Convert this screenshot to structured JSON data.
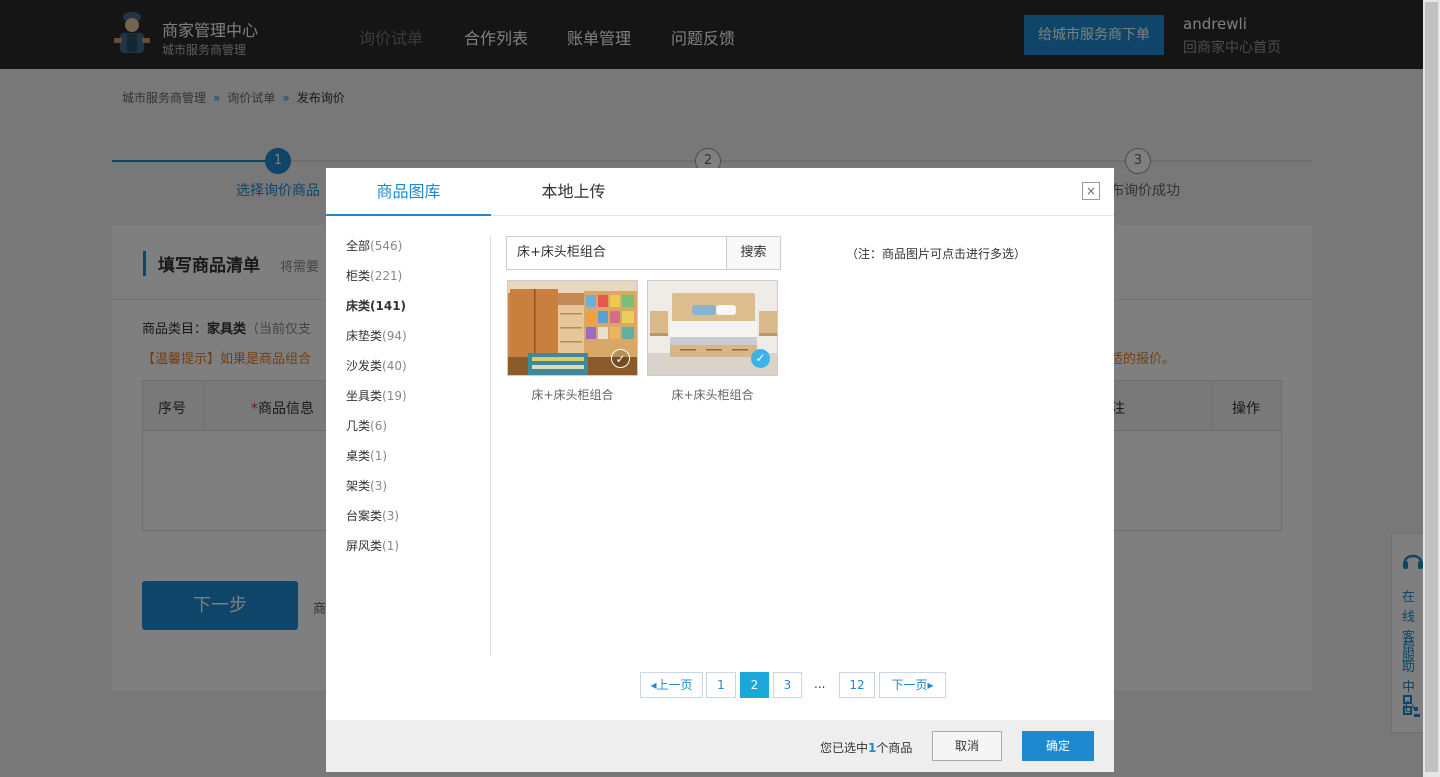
{
  "header": {
    "brand_title": "商家管理中心",
    "brand_subtitle": "城市服务商管理",
    "nav": [
      "询价试单",
      "合作列表",
      "账单管理",
      "问题反馈"
    ],
    "order_button": "给城市服务商下单",
    "user_name": "andrewli",
    "user_link": "回商家中心首页"
  },
  "breadcrumb": [
    "城市服务商管理",
    "询价试单",
    "发布询价"
  ],
  "breadcrumb_sep": "»",
  "steps": [
    {
      "num": "1",
      "label": "选择询价商品"
    },
    {
      "num": "2",
      "label": ""
    },
    {
      "num": "3",
      "label": "布询价成功"
    }
  ],
  "card": {
    "title": "填写商品清单",
    "title_hint": "将需要",
    "category_label": "商品类目：",
    "category_value": "家具类",
    "category_hint": "（当前仅支",
    "tip": "【温馨提示】如果是商品组合",
    "tip_right": "适的报价。",
    "table_headers": [
      "序号",
      "*商品信息",
      "注",
      "操作"
    ],
    "next_button": "下一步",
    "next_hint": "商"
  },
  "side_widget": {
    "service": "在线客服",
    "help": "帮助中心"
  },
  "modal": {
    "tabs": [
      "商品图库",
      "本地上传"
    ],
    "close": "×",
    "categories": [
      {
        "name": "全部",
        "count": "(546)"
      },
      {
        "name": "柜类",
        "count": "(221)"
      },
      {
        "name": "床类",
        "count": "(141)"
      },
      {
        "name": "床垫类",
        "count": "(94)"
      },
      {
        "name": "沙发类",
        "count": "(40)"
      },
      {
        "name": "坐具类",
        "count": "(19)"
      },
      {
        "name": "几类",
        "count": "(6)"
      },
      {
        "name": "桌类",
        "count": "(1)"
      },
      {
        "name": "架类",
        "count": "(3)"
      },
      {
        "name": "台案类",
        "count": "(3)"
      },
      {
        "name": "屏风类",
        "count": "(1)"
      }
    ],
    "active_category": "床类",
    "search_value": "床+床头柜组合",
    "search_button": "搜索",
    "note": "（注：商品图片可点击进行多选）",
    "products": [
      {
        "caption": "床+床头柜组合",
        "selected": false
      },
      {
        "caption": "床+床头柜组合",
        "selected": true
      }
    ],
    "pagination": {
      "prev": "上一页",
      "pages": [
        "1",
        "2",
        "3"
      ],
      "current": "2",
      "ellipsis": "...",
      "last": "12",
      "next": "下一页"
    },
    "footer": {
      "selected_prefix": "您已选中",
      "selected_count": "1",
      "selected_suffix": "个商品",
      "cancel": "取消",
      "confirm": "确定"
    }
  },
  "colors": {
    "accent": "#1d8ad0",
    "header_bg": "#2b2b2b",
    "warning": "#e67e22",
    "check_on": "#3ab4e8"
  }
}
